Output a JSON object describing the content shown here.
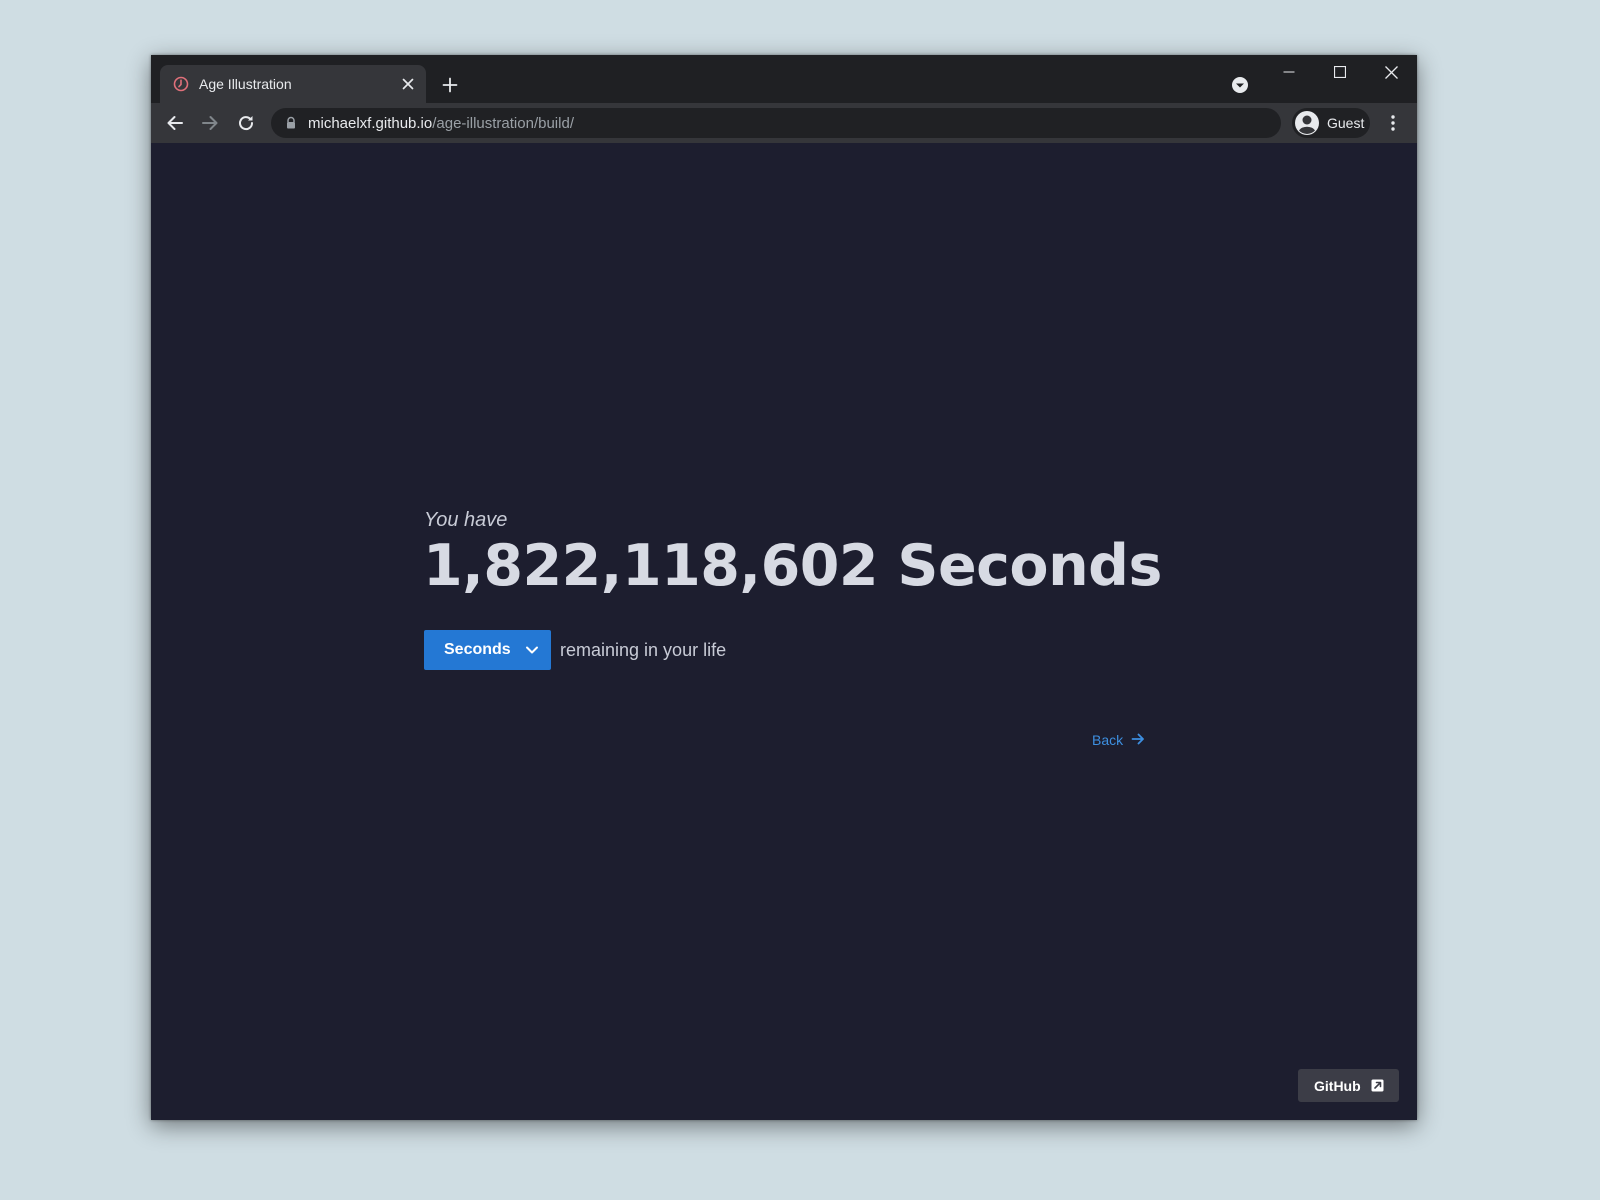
{
  "browser": {
    "tab": {
      "title": "Age Illustration",
      "favicon": "clock-icon",
      "close_icon": "close-icon"
    },
    "new_tab_icon": "plus-icon",
    "tab_search_icon": "chevron-down-circle-icon",
    "window_controls": [
      "minimize-icon",
      "maximize-icon",
      "close-icon"
    ],
    "nav": {
      "back_icon": "arrow-left-icon",
      "forward_icon": "arrow-right-icon",
      "reload_icon": "reload-icon"
    },
    "address_bar": {
      "lock_icon": "lock-icon",
      "host": "michaelxf.github.io",
      "path": "/age-illustration/build/"
    },
    "profile": {
      "label": "Guest",
      "icon": "avatar-icon"
    },
    "menu_icon": "kebab-menu-icon"
  },
  "page": {
    "intro": "You have",
    "value": "1,822,118,602 Seconds",
    "unit_select": {
      "selected": "Seconds",
      "icon": "chevron-down-icon"
    },
    "suffix": "remaining in your life",
    "back_link": {
      "label": "Back",
      "icon": "arrow-right-icon"
    },
    "github_button": {
      "label": "GitHub",
      "icon": "external-link-icon"
    }
  },
  "colors": {
    "page_background": "#1d1e2f",
    "accent": "#2478d4",
    "link": "#3d8fe0",
    "chrome_dark": "#1f2023",
    "chrome_toolbar": "#35363a"
  }
}
